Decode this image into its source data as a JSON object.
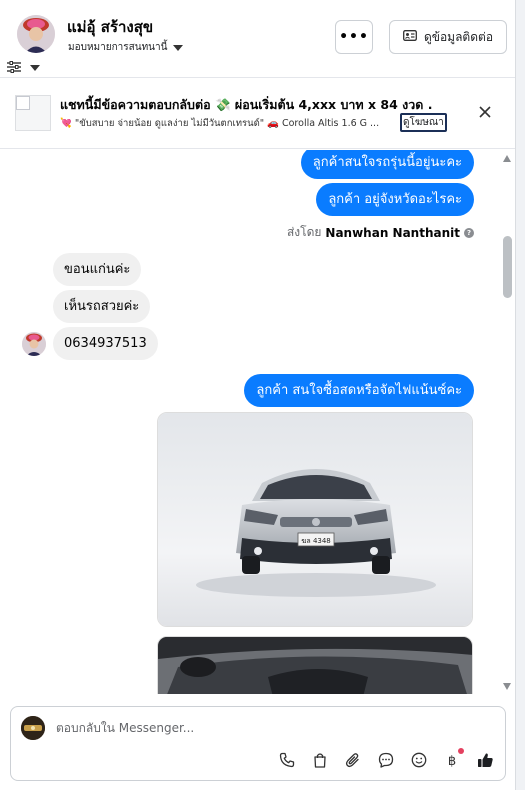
{
  "header": {
    "contact_name": "แม่อุ้ สร้างสุข",
    "assign_label": "มอบหมายการสนทนานี้",
    "more_label": "•••",
    "view_contact_label": "ดูข้อมูลติดต่อ"
  },
  "ad_banner": {
    "title": "แชทนี้มีข้อความตอบกลับต่อ 💸 ผ่อนเริ่มต้น 4,xxx บาท x 84 งวด .",
    "description": "💘 \"ขับสบาย จ่ายน้อย ดูแลง่าย ไม่มีวันตกเทรนด์\" 🚗 Corolla Altis 1.6 G ...",
    "link_label": "ดูโฆษณา"
  },
  "messages": {
    "out_1": "ลูกค้าสนใจรถรุ่นนี้อยู่นะคะ",
    "out_2": "ลูกค้า อยู่จังหวัดอะไรคะ",
    "sent_by_prefix": "ส่งโดย",
    "sent_by_name": "Nanwhan Nanthanit",
    "in_1": "ขอนแก่นค่ะ",
    "in_2": "เห็นรถสวยค่ะ",
    "in_3": "0634937513",
    "out_3": "ลูกค้า สนใจซื้อสดหรือจัดไฟแน้นซ์คะ",
    "plate_text": "ฆล 4348"
  },
  "composer": {
    "placeholder": "ตอบกลับใน Messenger..."
  },
  "colors": {
    "accent": "#0a7cff",
    "incoming_bubble": "#f0f0f0",
    "notification_dot": "#e4405f"
  },
  "icons": {
    "tools": [
      "phone-icon",
      "shopping-bag-icon",
      "paperclip-icon",
      "chat-bubble-icon",
      "emoji-icon",
      "baht-icon",
      "thumbs-up-icon"
    ]
  }
}
